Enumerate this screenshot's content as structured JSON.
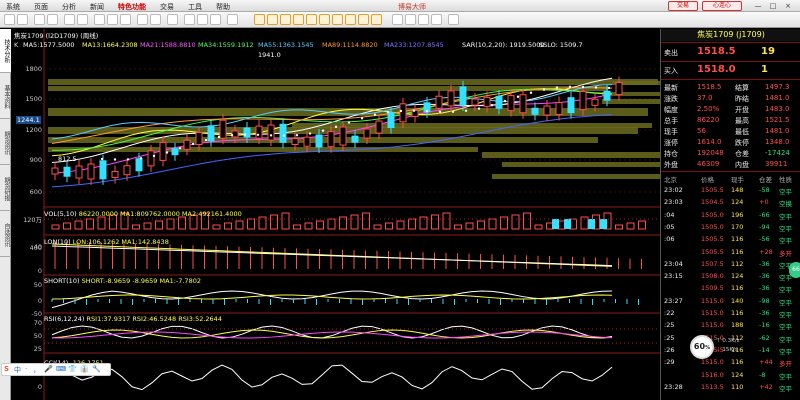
{
  "menu": {
    "items": [
      "系统",
      "页面",
      "分析",
      "新闻",
      "特色功能",
      "交易",
      "工具",
      "帮助"
    ],
    "active": "特色功能",
    "app_title": "博易大师",
    "trade_button": "交易",
    "heart_button": "心连心",
    "window_controls": [
      "—",
      "□",
      "×"
    ]
  },
  "left_tabs": [
    "技术分析",
    "基本资料",
    "期货资讯",
    "期货研报",
    "自选资讯"
  ],
  "chart": {
    "header": "焦炭1709 (l2D1709) (周线)",
    "main_indicators": [
      {
        "label": "K",
        "color": "#dddddd"
      },
      {
        "label": "MA5:1577.5000",
        "color": "#ffffff"
      },
      {
        "label": "MA13:1664.2308",
        "color": "#ffff55"
      },
      {
        "label": "MA21:1588.8810",
        "color": "#ff55ff"
      },
      {
        "label": "MA34:1559.1912",
        "color": "#55ff55"
      },
      {
        "label": "MA55:1363.1545",
        "color": "#55ccff"
      },
      {
        "label": "MA89:1114.8820",
        "color": "#ff9933"
      },
      {
        "label": "MA233:1207.8545",
        "color": "#7777ff"
      },
      {
        "label": "SAR(10,2,20): 1919.5000",
        "color": "#ffffff"
      },
      {
        "label": "SSLO: 1509.7",
        "color": "#ffffff"
      }
    ],
    "price_axis": [
      "1800",
      "1500",
      "1200",
      "900",
      "600"
    ],
    "high_marker": "1941.0",
    "low_marker": "812.5",
    "last_price_label": "1244.1",
    "panels": [
      {
        "title": "VOL(5,10)",
        "values": "86220.0000  MA1:809762.0000  MA2:492161.4000",
        "axis": [
          "120万",
          "40"
        ]
      },
      {
        "title": "LON(10)",
        "values": "LON:106.1262  MA1:142.8438",
        "axis": [
          "400",
          "0"
        ]
      },
      {
        "title": "SHORT(10)",
        "values": "SHORT:-8.9659  -8.9659  MA1:-7.7802",
        "axis": [
          "50",
          "0",
          "-50"
        ]
      },
      {
        "title": "RSI(6,12,24)",
        "values": "RSI1:37.9317  RSI2:46.5248  RSI3:52.2644",
        "axis": [
          "70",
          "50",
          "25"
        ]
      },
      {
        "title": "CCI(14)",
        "values": "-126.1751",
        "axis": [
          "100",
          "0"
        ]
      }
    ]
  },
  "quote": {
    "title": "焦炭1709 (j1709)",
    "sell": {
      "label": "卖出",
      "price": "1518.5",
      "vol": "19"
    },
    "buy": {
      "label": "买入",
      "price": "1518.0",
      "vol": "1"
    },
    "stats": [
      [
        "最新",
        "1518.5",
        "结算",
        "1497.3"
      ],
      [
        "涨跌",
        "37.0",
        "昨结",
        "1481.0"
      ],
      [
        "幅度",
        "2.50%",
        "开盘",
        "1483.0"
      ],
      [
        "总手",
        "86220",
        "最高",
        "1521.5"
      ],
      [
        "现手",
        "56",
        "最低",
        "1481.0"
      ],
      [
        "涨停",
        "1614.0",
        "跌停",
        "1348.0"
      ],
      [
        "持仓",
        "192048",
        "仓差",
        "-17424"
      ],
      [
        "外盘",
        "46309",
        "内盘",
        "39911"
      ]
    ],
    "tick_header": [
      "北京",
      "价格",
      "现手",
      "仓差",
      "性质"
    ],
    "ticks": [
      [
        "23:02",
        "1505.5",
        "148",
        "-58",
        "空平"
      ],
      [
        "23:03",
        "1504.5",
        "124",
        "+0",
        "空换"
      ],
      [
        ":04",
        "1505.0",
        "196",
        "-66",
        "空平"
      ],
      [
        ":05",
        "1505.0",
        "170",
        "-94",
        "空平"
      ],
      [
        ":06",
        "1505.5",
        "116",
        "-56",
        "空平"
      ],
      [
        "",
        "1505.5",
        "116",
        "+28",
        "多开"
      ],
      [
        "23:04",
        "1507.5",
        "112",
        "-36",
        "空平"
      ],
      [
        "23:15",
        "1508.0",
        "124",
        "-36",
        "空平"
      ],
      [
        "",
        "1509.5",
        "116",
        "-36",
        "空平"
      ],
      [
        "23:27",
        "1515.0",
        "140",
        "-98",
        "空平"
      ],
      [
        ":22",
        "1515.0",
        "116",
        "-36",
        "空平"
      ],
      [
        ":25",
        "1515.0",
        "188",
        "-16",
        "空平"
      ],
      [
        ":25",
        "1515.0",
        "112",
        "-62",
        "空平"
      ],
      [
        ":26",
        "1515.5",
        "116",
        "-14",
        "空平"
      ],
      [
        ":29",
        "1515.0",
        "116",
        "+44",
        "多开"
      ],
      [
        "",
        "1516.0",
        "124",
        "-8",
        "空平"
      ],
      [
        "23:28",
        "1513.5",
        "110",
        "+42",
        "空平"
      ]
    ]
  },
  "overlay": {
    "ime": [
      "S",
      "中",
      "·",
      "，",
      "🎤",
      "⌨",
      "👕",
      "👔",
      "🔧"
    ],
    "speed_percent": "60",
    "speed_unit": "%",
    "net_up": "0.3K/s",
    "net_down": "15K/s",
    "side_badge": "66"
  }
}
